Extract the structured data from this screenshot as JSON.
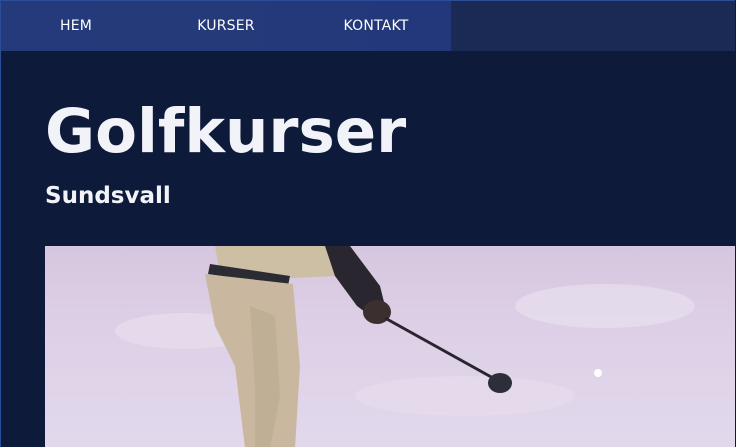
{
  "nav": {
    "items": [
      {
        "label": "HEM"
      },
      {
        "label": "KURSER"
      },
      {
        "label": "KONTAKT"
      }
    ]
  },
  "hero": {
    "title": "Golfkurser",
    "subtitle": "Sundsvall"
  },
  "image": {
    "subject": "golfer-swinging-club"
  },
  "colors": {
    "background": "#0d1a3a",
    "nav_background": "#243a7a",
    "text": "#f1f3f8"
  }
}
